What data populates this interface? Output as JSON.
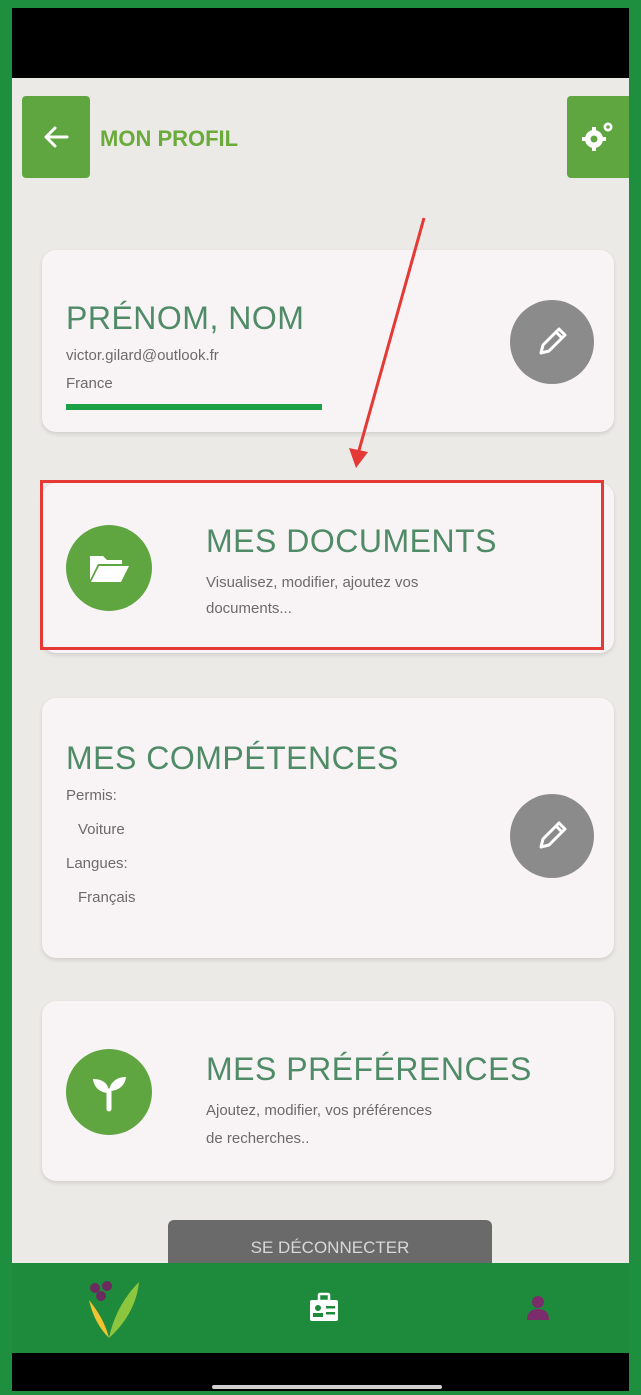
{
  "header": {
    "title": "MON PROFIL",
    "back_icon": "arrow-left-icon",
    "settings_icon": "gears-icon"
  },
  "identity": {
    "name": "PRÉNOM, NOM",
    "email": "victor.gilard@outlook.fr",
    "country": "France",
    "edit_icon": "pencil-icon"
  },
  "documents": {
    "title": "MES DOCUMENTS",
    "description_line1": "Visualisez, modifier, ajoutez vos",
    "description_line2": "documents...",
    "icon": "folder-open-icon"
  },
  "skills": {
    "title": "MES COMPÉTENCES",
    "permits_label": "Permis:",
    "permits_value": "Voiture",
    "languages_label": "Langues:",
    "languages_value": "Français",
    "edit_icon": "pencil-icon"
  },
  "preferences": {
    "title": "MES PRÉFÉRENCES",
    "description_line1": "Ajoutez, modifier, vos préférences",
    "description_line2": "de recherches..",
    "icon": "sprout-icon"
  },
  "logout_label": "SE DÉCONNECTER",
  "bottom_nav": [
    {
      "name": "home",
      "icon": "app-logo-icon"
    },
    {
      "name": "card",
      "icon": "id-badge-icon"
    },
    {
      "name": "profile",
      "icon": "user-icon"
    }
  ],
  "colors": {
    "outer_border": "#1e8f3e",
    "accent_green": "#5fa640",
    "title_green": "#4f8b67",
    "nav_green": "#1d8a3c",
    "highlight_red": "#e53935",
    "underline_green": "#1ca046"
  }
}
